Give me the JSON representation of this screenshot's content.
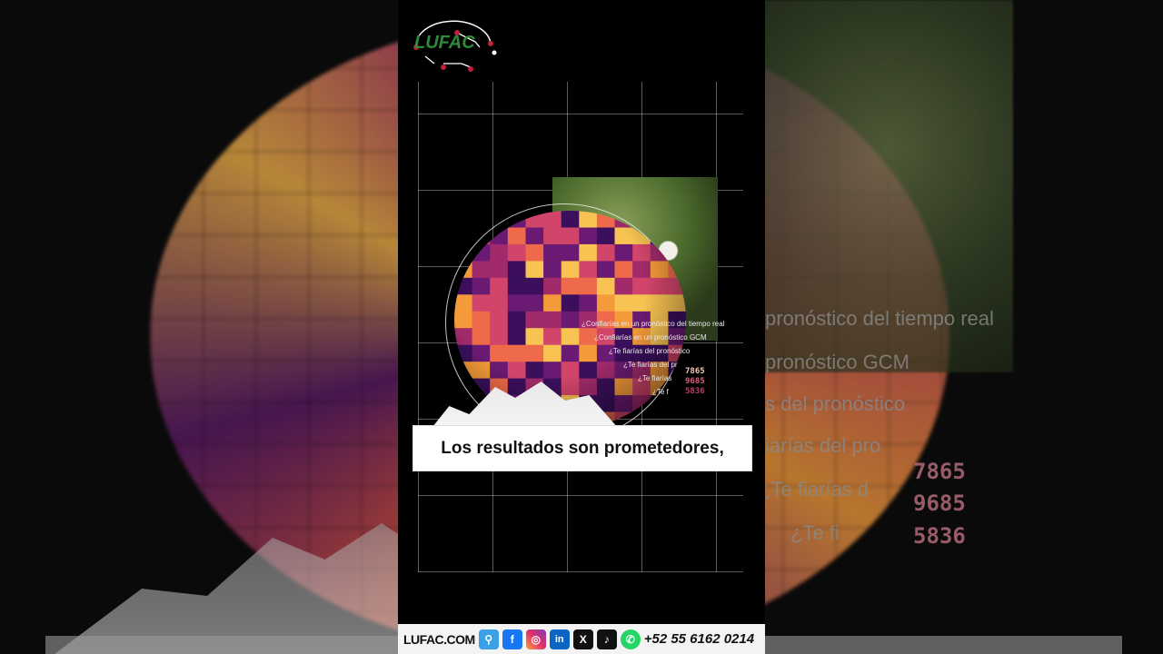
{
  "brand": {
    "logo_text": "LUFAC"
  },
  "caption": {
    "text": "Los resultados son prometedores,"
  },
  "overlay_lines": [
    "¿Confiarías en un pronóstico del tiempo real",
    "¿Confiarías en un pronóstico GCM",
    "¿Te fiarías del pronóstico",
    "¿Te fiarías del pr",
    "¿Te fiarías",
    "¿Te f"
  ],
  "overlay_numbers": [
    "7865",
    "9685",
    "5836"
  ],
  "background_text": {
    "lines": [
      "pronóstico del tiempo real",
      "pronóstico GCM",
      "s del pronóstico",
      "iarías del pro",
      "¿Te fiarías d",
      "¿Te fi"
    ],
    "numbers": [
      "7865",
      "9685",
      "5836"
    ]
  },
  "footer": {
    "domain": "LUFAC.COM",
    "icons": [
      "search-icon",
      "facebook-icon",
      "instagram-icon",
      "linkedin-icon",
      "x-icon",
      "tiktok-icon",
      "whatsapp-icon"
    ],
    "phone": "+52 55 6162 0214"
  },
  "colors": {
    "brand_green": "#2e8a3a",
    "brand_red": "#c0203a",
    "heatmap": [
      "#3b0f5c",
      "#6a1a72",
      "#a02a6a",
      "#d2456a",
      "#ee6a4a",
      "#f59a3a",
      "#f8c352"
    ]
  }
}
